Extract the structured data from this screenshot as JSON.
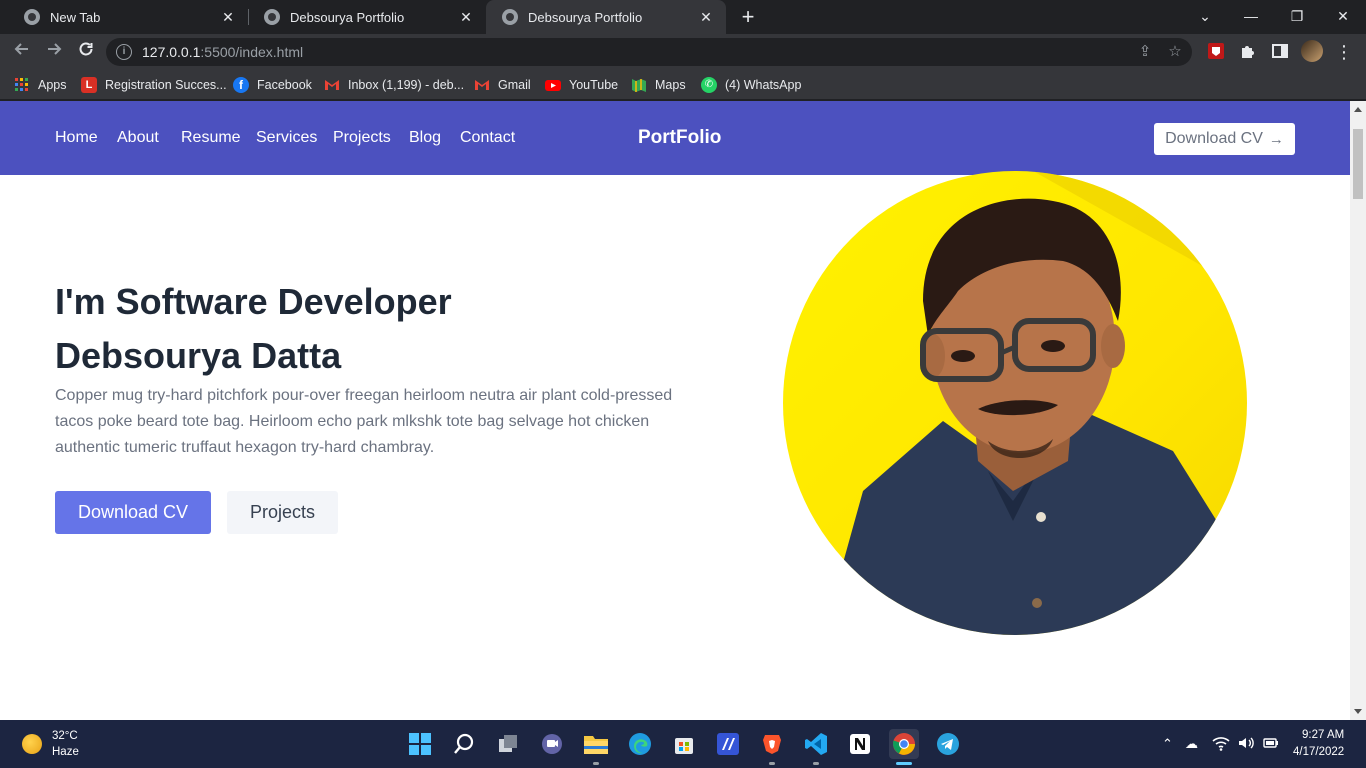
{
  "tabs": [
    {
      "title": "New Tab"
    },
    {
      "title": "Debsourya Portfolio"
    },
    {
      "title": "Debsourya Portfolio"
    }
  ],
  "window_controls": {
    "dropdown": "⌄",
    "minimize": "—",
    "restore": "❐",
    "close": "✕"
  },
  "address_bar": {
    "host": "127.0.0.1",
    "rest": ":5500/index.html"
  },
  "bookmarks": [
    {
      "label": "Apps",
      "icon": "apps-grid-icon",
      "color": "#ea4335"
    },
    {
      "label": "Registration Succes...",
      "icon": "registration-icon",
      "color": "#d93025"
    },
    {
      "label": "Facebook",
      "icon": "facebook-icon",
      "color": "#1877f2"
    },
    {
      "label": "Inbox (1,199) - deb...",
      "icon": "gmail-icon",
      "color": "#ea4335"
    },
    {
      "label": "Gmail",
      "icon": "gmail-icon",
      "color": "#ea4335"
    },
    {
      "label": "YouTube",
      "icon": "youtube-icon",
      "color": "#ff0000"
    },
    {
      "label": "Maps",
      "icon": "maps-icon",
      "color": "#34a853"
    },
    {
      "label": "(4) WhatsApp",
      "icon": "whatsapp-icon",
      "color": "#25d366"
    }
  ],
  "nav": {
    "links": [
      "Home",
      "About",
      "Resume",
      "Services",
      "Projects",
      "Blog",
      "Contact"
    ],
    "brand": "PortFolio",
    "cta": "Download CV",
    "accent": "#4c51bf"
  },
  "hero": {
    "subtitle": "I'm Software Developer",
    "name": "Debsourya Datta",
    "description": "Copper mug try-hard pitchfork pour-over freegan heirloom neutra air plant cold-pressed tacos poke beard tote bag. Heirloom echo park mlkshk tote bag selvage hot chicken authentic tumeric truffaut hexagon try-hard chambray.",
    "primary_button": "Download CV",
    "secondary_button": "Projects",
    "primary_color": "#6574e8"
  },
  "taskbar": {
    "weather_temp": "32°C",
    "weather_desc": "Haze",
    "time": "9:27 AM",
    "date": "4/17/2022",
    "apps": [
      "start",
      "search",
      "task-view",
      "chat",
      "file-explorer",
      "edge",
      "store",
      "vs-code-insiders",
      "brave",
      "vs-code",
      "notion",
      "chrome",
      "telegram"
    ]
  }
}
